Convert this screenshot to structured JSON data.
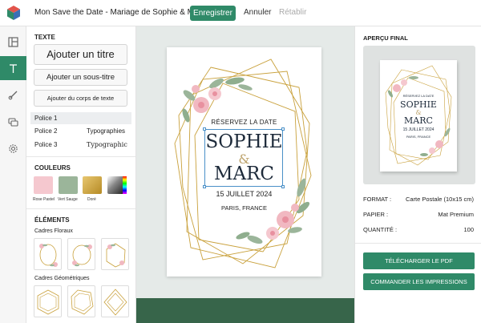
{
  "header": {
    "title": "Mon Save the Date - Mariage de Sophie & Marc",
    "save_label": "Enregistrer",
    "undo_label": "Annuler",
    "redo_label": "Rétablir"
  },
  "rail": {
    "icons": [
      "layout-icon",
      "text-icon",
      "brush-icon",
      "comment-icon",
      "gear-icon"
    ],
    "active": "text-icon"
  },
  "left_panel": {
    "texte_title": "TEXTE",
    "add_title": "Ajouter un titre",
    "add_subtitle": "Ajouter un sous-titre",
    "add_body": "Ajouter du corps de texte",
    "police": [
      {
        "label": "Police 1",
        "sample": ""
      },
      {
        "label": "Police 2",
        "sample": "Typographies"
      },
      {
        "label": "Police 3",
        "sample": "Typographic"
      }
    ],
    "couleurs_title": "COULEURS",
    "colors": [
      {
        "label": "Rose Pastel",
        "hex": "#f5c8cf"
      },
      {
        "label": "Vert Sauge",
        "hex": "#9bb59a"
      },
      {
        "label": "Doré",
        "hex": "#c9a13c"
      }
    ],
    "elements_title": "ÉLÉMENTS",
    "cadres_floraux": "Cadres Floraux",
    "cadres_geometriques": "Cadres Géométriques"
  },
  "card": {
    "reserve": "RÉSERVEZ LA DATE",
    "name1": "SOPHIE",
    "amp": "&",
    "name2": "MARC",
    "date": "15 JUILLET 2024",
    "place": "PARIS, FRANCE"
  },
  "right_panel": {
    "title": "APERÇU FINAL",
    "preview": {
      "reserve": "RÉSERVEZ LA DATE",
      "name1": "SOPHIE",
      "amp": "&",
      "name2": "MARC",
      "date": "15 JUILLET 2024",
      "place": "PARIS, FRANCE"
    },
    "format_label": "FORMAT :",
    "format_value": "Carte Postale (10x15 cm)",
    "papier_label": "PAPIER :",
    "papier_value": "Mat Premium",
    "quantite_label": "QUANTITÉ :",
    "quantite_value": "100",
    "download_label": "TÉLÉCHARGER LE PDF",
    "order_label": "COMMANDER LES IMPRESSIONS"
  },
  "colors": {
    "accent": "#2f8a68",
    "gold": "#c9a13c",
    "rose": "#f5c8cf",
    "sage": "#9bb59a"
  }
}
